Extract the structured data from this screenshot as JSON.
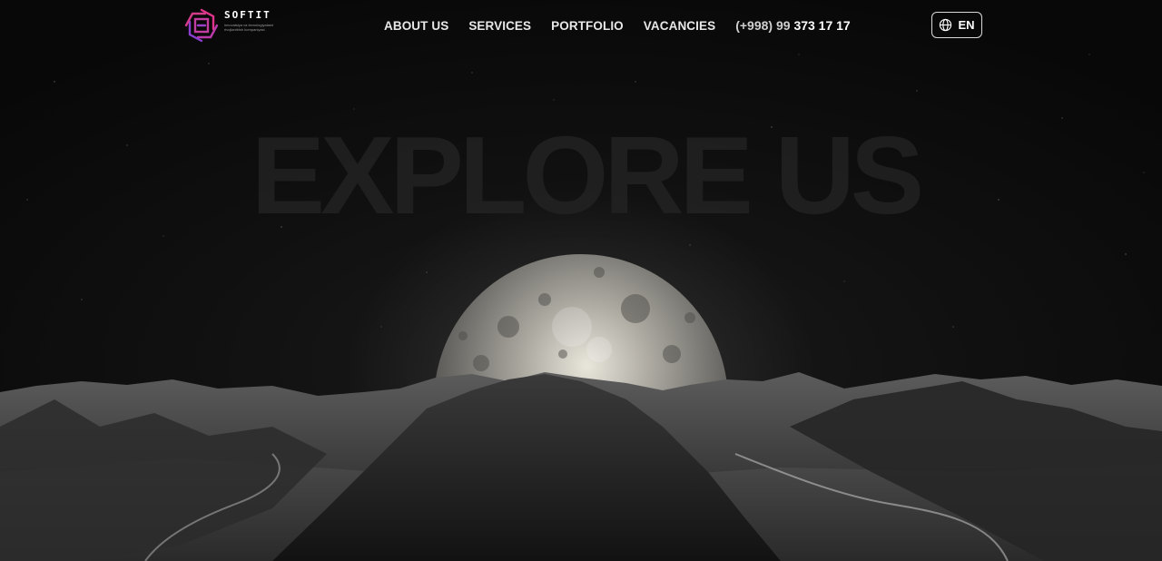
{
  "header": {
    "logo": {
      "name": "SOFTIT",
      "tagline": "innovatsiya va texnologiyalarni rivojlantirish kompaniyasi"
    },
    "nav": [
      {
        "label": "ABOUT US"
      },
      {
        "label": "SERVICES"
      },
      {
        "label": "PORTFOLIO"
      },
      {
        "label": "VACANCIES"
      }
    ],
    "phone": {
      "prefix": "(+998) 99 ",
      "number": "373 17 17"
    },
    "language": {
      "label": "EN",
      "icon": "globe-icon"
    }
  },
  "hero": {
    "title": "EXPLORE US",
    "background": "moon-over-mountains-image"
  },
  "colors": {
    "background": "#0b0b0b",
    "logo_accent_pink": "#e0348c",
    "logo_accent_purple": "#8a3fd1"
  }
}
